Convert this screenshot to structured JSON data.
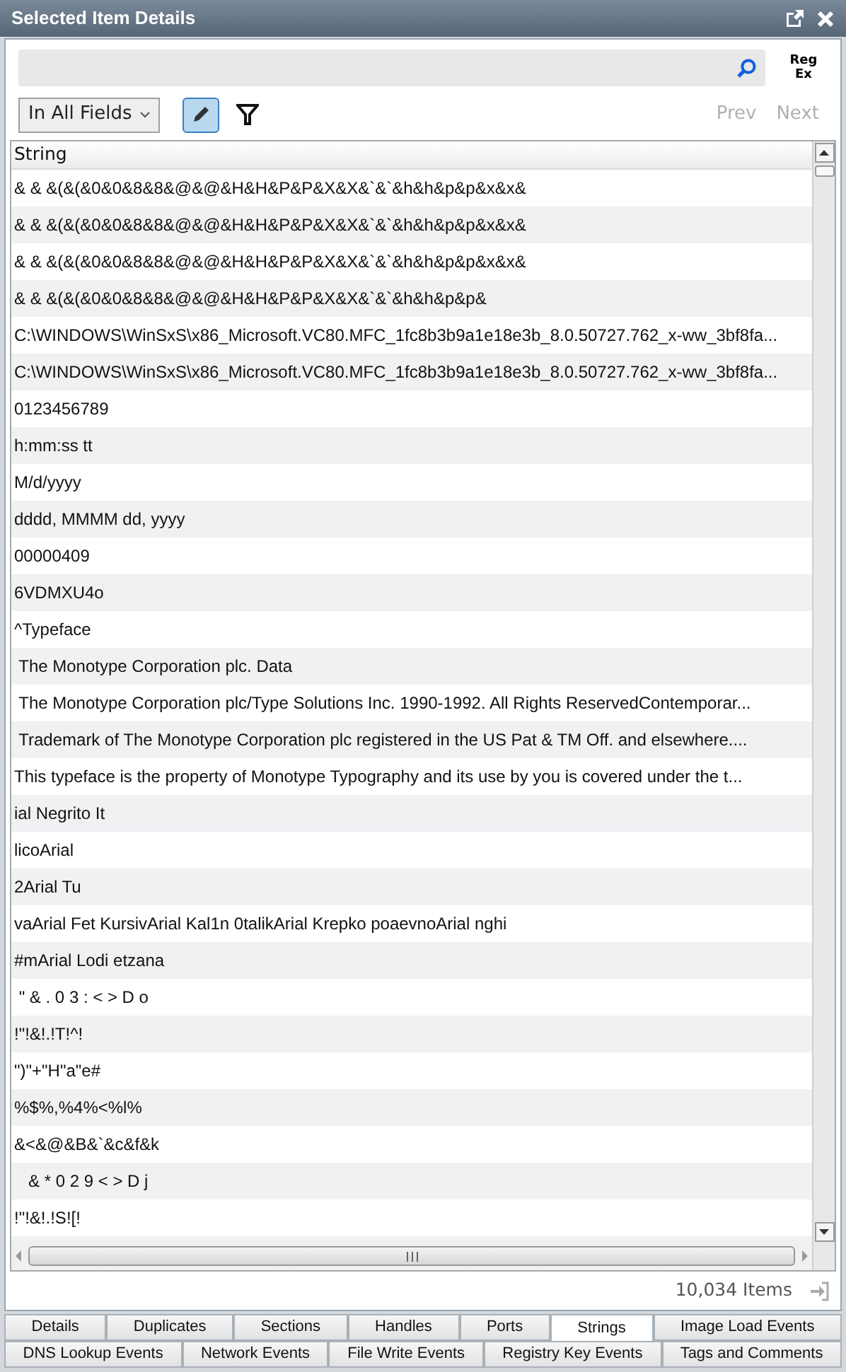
{
  "window": {
    "title": "Selected Item Details"
  },
  "search": {
    "regex_label_top": "Reg",
    "regex_label_bottom": "Ex"
  },
  "scope_dropdown": {
    "value": "In All Fields"
  },
  "highlight_toggle": {
    "on": true
  },
  "nav": {
    "prev": "Prev",
    "next": "Next",
    "prev_disabled": true,
    "next_disabled": true
  },
  "table": {
    "columns": [
      "String"
    ],
    "rows": [
      "& & &(&(&0&0&8&8&@&@&H&H&P&P&X&X&`&`&h&h&p&p&x&x&",
      "& & &(&(&0&0&8&8&@&@&H&H&P&P&X&X&`&`&h&h&p&p&x&x&",
      "& & &(&(&0&0&8&8&@&@&H&H&P&P&X&X&`&`&h&h&p&p&x&x&",
      "& & &(&(&0&0&8&8&@&@&H&H&P&P&X&X&`&`&h&h&p&p&",
      "C:\\WINDOWS\\WinSxS\\x86_Microsoft.VC80.MFC_1fc8b3b9a1e18e3b_8.0.50727.762_x-ww_3bf8fa...",
      "C:\\WINDOWS\\WinSxS\\x86_Microsoft.VC80.MFC_1fc8b3b9a1e18e3b_8.0.50727.762_x-ww_3bf8fa...",
      "0123456789",
      "h:mm:ss tt",
      "M/d/yyyy",
      "dddd, MMMM dd, yyyy",
      "00000409",
      "6VDMXU4o",
      "^Typeface",
      " The Monotype Corporation plc. Data",
      " The Monotype Corporation plc/Type Solutions Inc. 1990-1992. All Rights ReservedContemporar...",
      " Trademark of The Monotype Corporation plc registered in the US Pat & TM Off. and elsewhere....",
      "This typeface is the property of Monotype Typography and its use by you is covered under the t...",
      "ial Negrito It",
      "licoArial",
      "2Arial Tu",
      "vaArial Fet KursivArial Kal1n 0talikArial Krepko poaevnoArial nghi",
      "#mArial Lodi etzana",
      " \" & . 0 3 : < > D o",
      "!\"!&!.!T!^!",
      "\")\"+\"H\"a\"e#",
      "%$%,%4%<%l%",
      "&<&@&B&`&c&f&k",
      "   & * 0 2 9 < > D j",
      "!\"!&!.!S![!"
    ]
  },
  "status": {
    "count": "10,034 Items"
  },
  "tab_rows": [
    [
      {
        "label": "Details",
        "selected": false
      },
      {
        "label": "Duplicates",
        "selected": false
      },
      {
        "label": "Sections",
        "selected": false
      },
      {
        "label": "Handles",
        "selected": false
      },
      {
        "label": "Ports",
        "selected": false
      },
      {
        "label": "Strings",
        "selected": true
      },
      {
        "label": "Image Load Events",
        "selected": false
      }
    ],
    [
      {
        "label": "DNS Lookup Events",
        "selected": false
      },
      {
        "label": "Network Events",
        "selected": false
      },
      {
        "label": "File Write Events",
        "selected": false
      },
      {
        "label": "Registry Key Events",
        "selected": false
      },
      {
        "label": "Tags and Comments",
        "selected": false
      }
    ]
  ]
}
